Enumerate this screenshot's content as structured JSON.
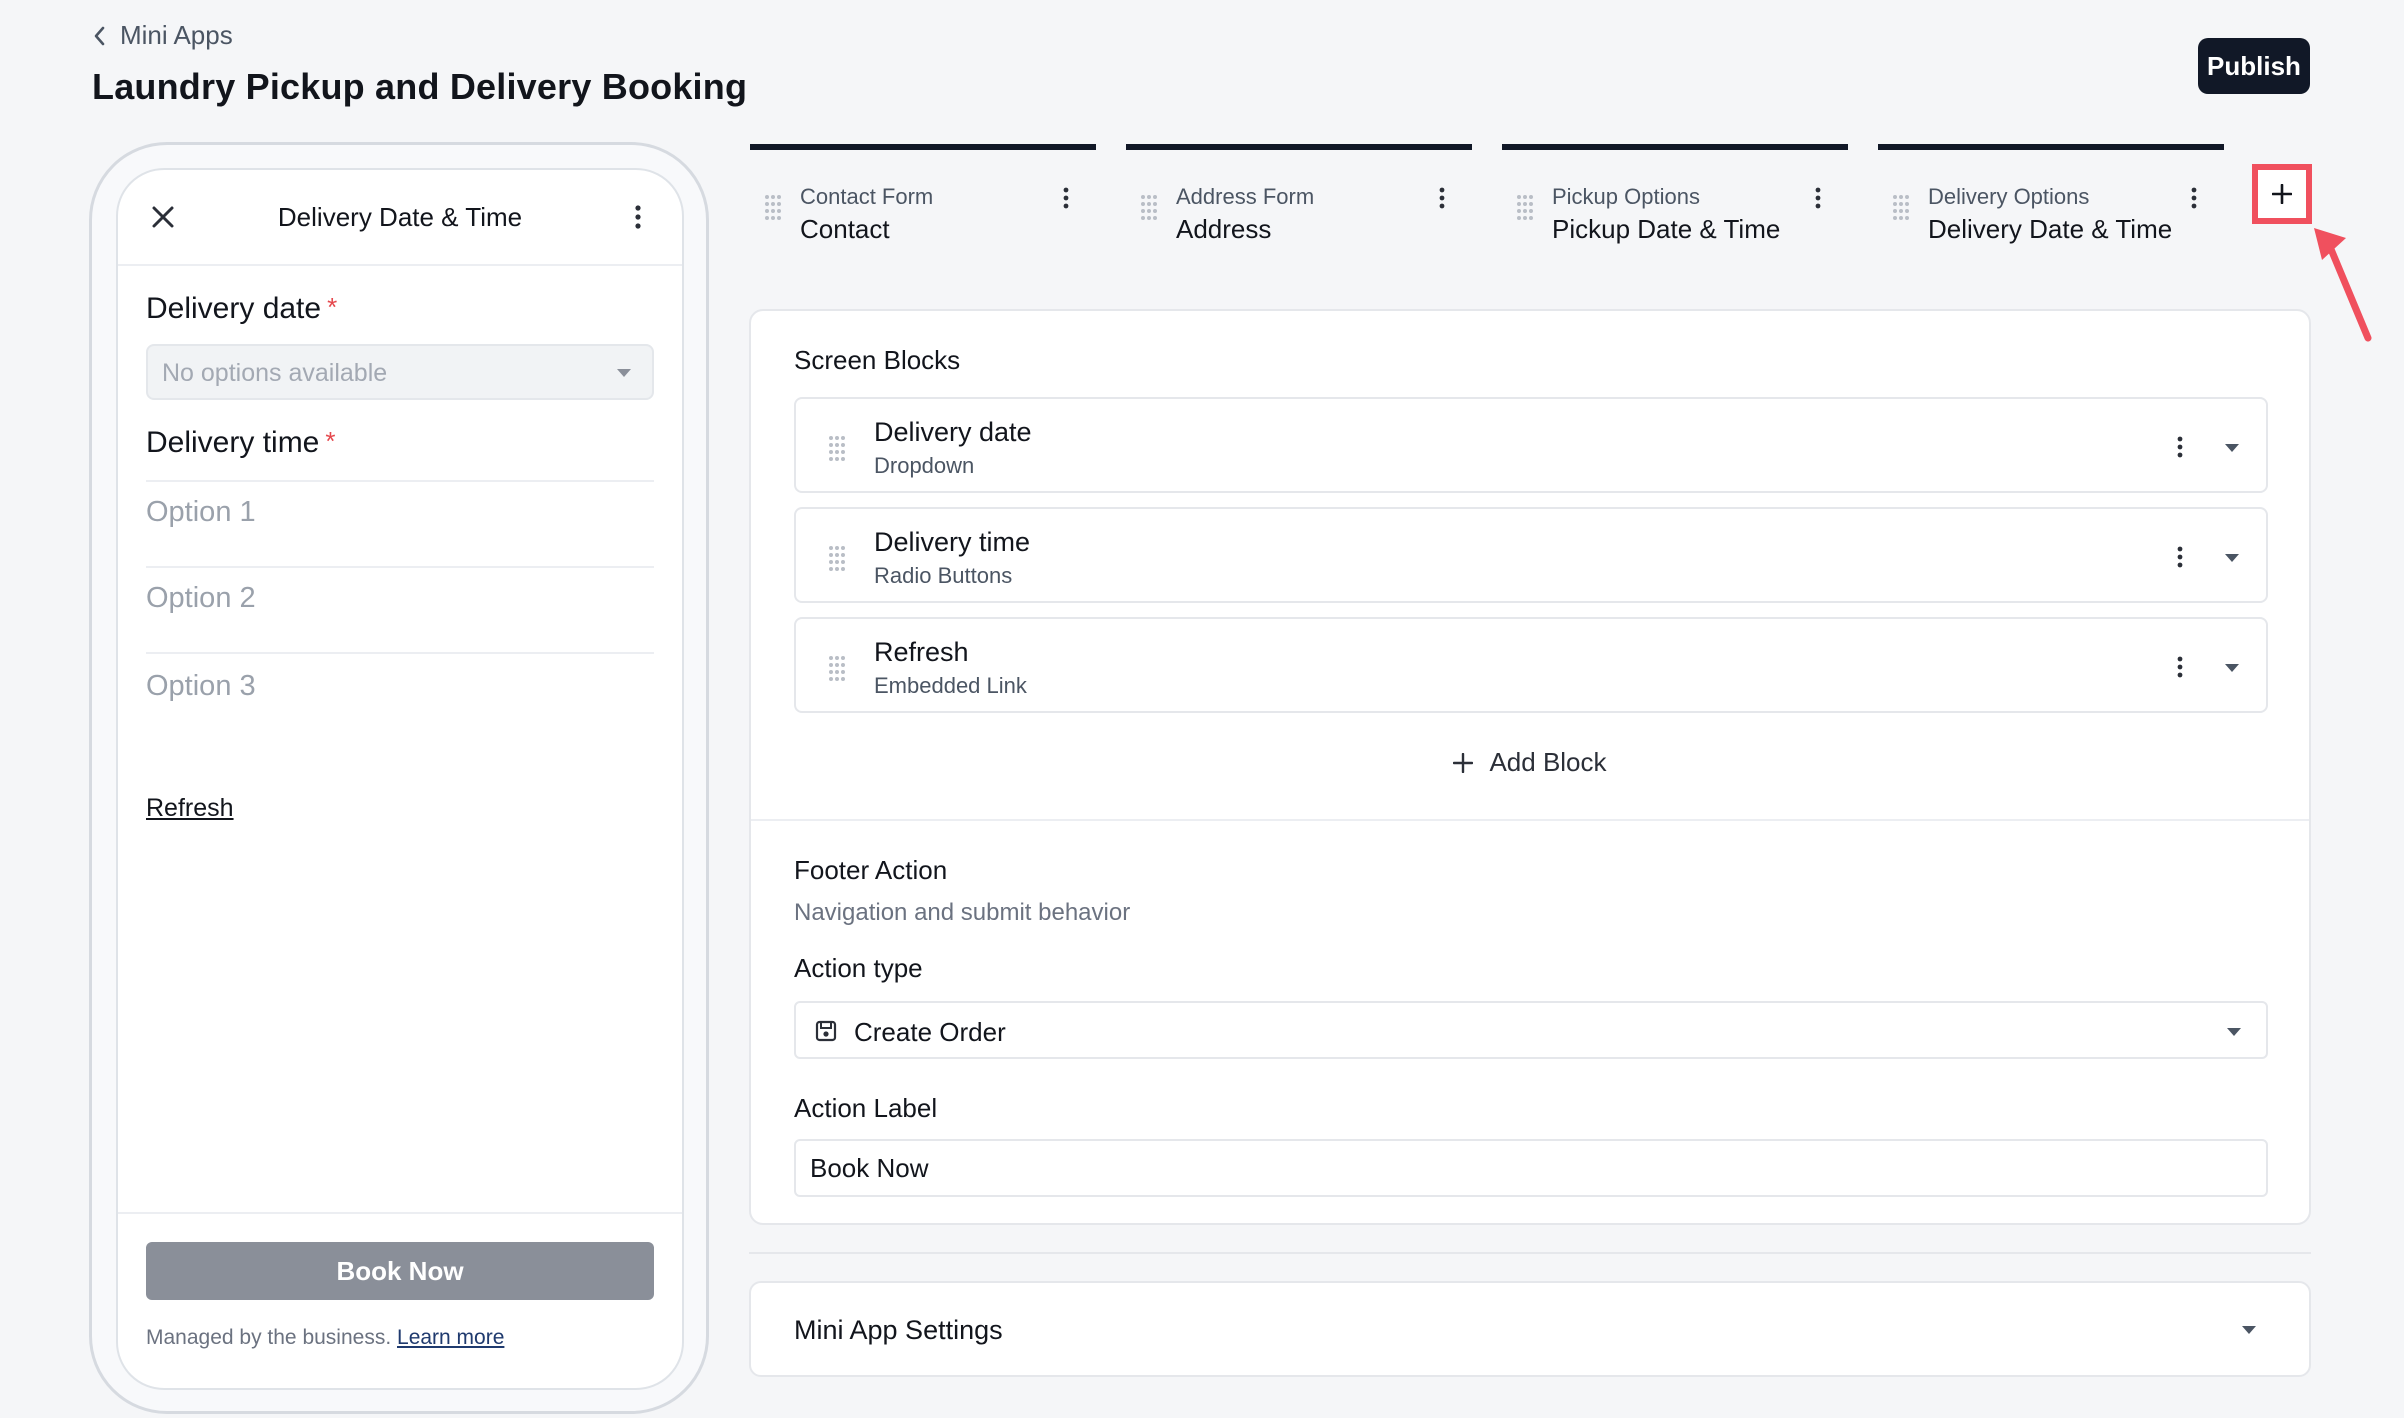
{
  "breadcrumb": {
    "back_label": "Mini Apps"
  },
  "page": {
    "title": "Laundry Pickup and Delivery Booking"
  },
  "toolbar": {
    "publish_label": "Publish"
  },
  "preview": {
    "screen_title": "Delivery Date & Time",
    "delivery_date_label": "Delivery date",
    "required_mark": "*",
    "delivery_date_value": "No options available",
    "delivery_time_label": "Delivery time",
    "options": [
      "Option 1",
      "Option 2",
      "Option 3"
    ],
    "refresh_link": "Refresh",
    "book_button": "Book Now",
    "managed_text": "Managed by the business.",
    "learn_more": "Learn more"
  },
  "tabs": [
    {
      "kind": "Contact Form",
      "name": "Contact"
    },
    {
      "kind": "Address Form",
      "name": "Address"
    },
    {
      "kind": "Pickup Options",
      "name": "Pickup Date & Time"
    },
    {
      "kind": "Delivery Options",
      "name": "Delivery Date & Time"
    }
  ],
  "editor": {
    "screen_blocks_title": "Screen Blocks",
    "blocks": [
      {
        "title": "Delivery date",
        "type": "Dropdown"
      },
      {
        "title": "Delivery time",
        "type": "Radio Buttons"
      },
      {
        "title": "Refresh",
        "type": "Embedded Link"
      }
    ],
    "add_block_label": "Add Block",
    "footer_title": "Footer Action",
    "footer_subtitle": "Navigation and submit behavior",
    "action_type_label": "Action type",
    "action_type_value": "Create Order",
    "action_label_label": "Action Label",
    "action_label_value": "Book Now"
  },
  "settings": {
    "title": "Mini App Settings"
  },
  "colors": {
    "primary_dark": "#111827",
    "highlight": "#f0505e",
    "required": "#e5484d",
    "disabled_button": "#8a8f99"
  }
}
